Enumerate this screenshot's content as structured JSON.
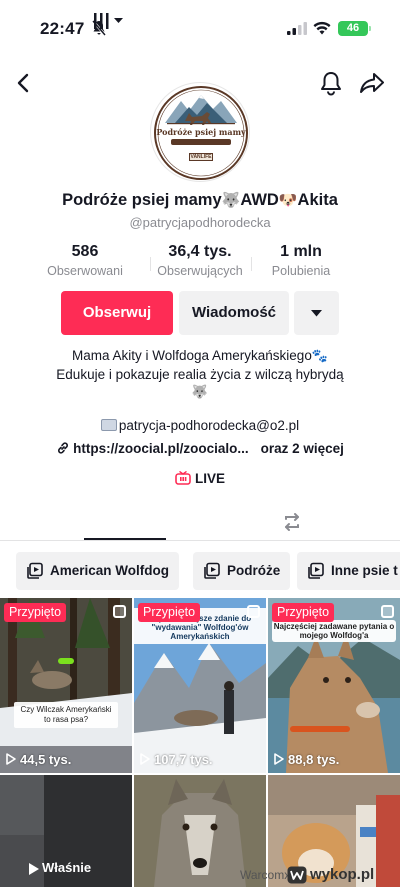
{
  "status_bar": {
    "time": "22:47",
    "battery": "46"
  },
  "profile": {
    "avatar_logo": {
      "line1": "Podróże psiej mamy",
      "brand": "VANLIFE"
    },
    "display_name": "Podróże psiej mamy",
    "display_name_emoji_1": "🐺",
    "display_name_mid": "AWD",
    "display_name_emoji_2": "🐶",
    "display_name_end": "Akita",
    "username": "@patrycjapodhorodecka",
    "stats": [
      {
        "value": "586",
        "label": "Obserwowani"
      },
      {
        "value": "36,4 tys.",
        "label": "Obserwujących"
      },
      {
        "value": "1 mln",
        "label": "Polubienia"
      }
    ],
    "buttons": {
      "follow": "Obserwuj",
      "message": "Wiadomość"
    },
    "bio": {
      "line1": "Mama Akity i Wolfdoga Amerykańskiego",
      "line1_emoji": "🐾",
      "line2": "Edukuje i pokazuje realia życia z wilczą hybrydą",
      "line3_emoji": "🐺"
    },
    "email": "patrycja-podhorodecka@o2.pl",
    "link": "https://zoocial.pl/zoocialo...",
    "link_more": "oraz 2 więcej",
    "live": "LIVE"
  },
  "chips": [
    "American Wolfdog",
    "Podróże",
    "Inne psie t"
  ],
  "videos": [
    {
      "pinned": "Przypięto",
      "views": "44,5 tys.",
      "caption": "Czy Wilczak Amerykański to rasa psa?"
    },
    {
      "pinned": "Przypięto",
      "views": "107,7 tys.",
      "caption": "Najzabawniejsze zdanie do \"wydawania\" Wolfdog'ów Amerykańskich"
    },
    {
      "pinned": "Przypięto",
      "views": "88,8 tys.",
      "caption": "Najczęściej zadawane pytania o mojego Wolfdog'a"
    },
    {
      "now_label": "Właśnie"
    },
    {},
    {}
  ],
  "watermark": {
    "user": "Warcomx z",
    "site": "wykop.pl"
  },
  "colors": {
    "accent": "#fe2c55",
    "chip_bg": "#f1f1f2",
    "muted_text": "#8a8b91"
  }
}
